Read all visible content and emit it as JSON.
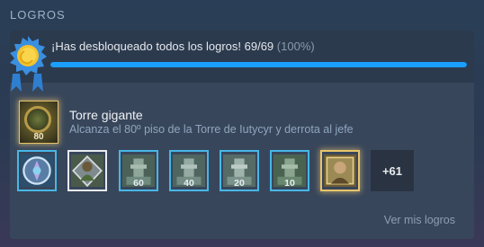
{
  "section_title": "LOGROS",
  "summary": {
    "text": "¡Has desbloqueado todos los logros! 69/69",
    "percent_text": "(100%)",
    "progress_fraction": 1.0,
    "accent_color": "#1a9fff",
    "medal_icon": "blue-rosette-medal-icon"
  },
  "featured": {
    "icon": "tower-achievement-icon",
    "icon_number": "80",
    "name": "Torre gigante",
    "description": "Alcanza el 80º piso de la Torre de Iutycyr y derrota al jefe"
  },
  "tiles": [
    {
      "icon": "crystal-shield-icon",
      "number": ""
    },
    {
      "icon": "cloaked-warrior-icon",
      "number": ""
    },
    {
      "icon": "tower-floor-icon",
      "number": "60"
    },
    {
      "icon": "tower-floor-icon",
      "number": "40"
    },
    {
      "icon": "tower-floor-icon",
      "number": "20"
    },
    {
      "icon": "tower-floor-icon",
      "number": "10"
    },
    {
      "icon": "portrait-icon",
      "number": ""
    }
  ],
  "more_count": "+61",
  "view_link": "Ver mis logros"
}
